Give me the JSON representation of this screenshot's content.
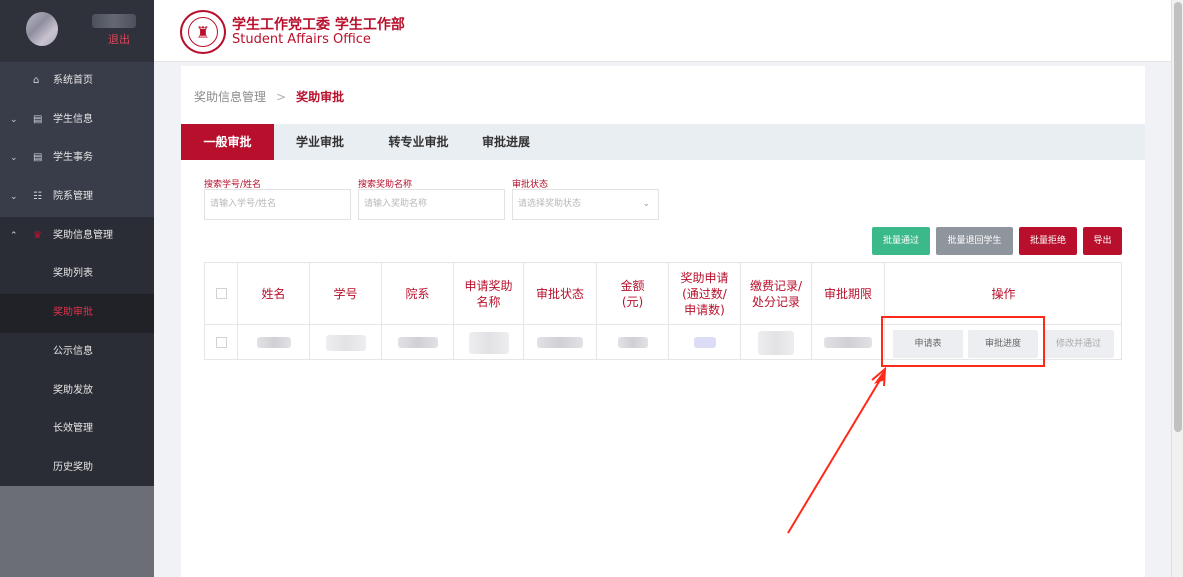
{
  "sidebar": {
    "logout": "退出",
    "items": [
      {
        "label": "系统首页",
        "icon": "home-icon"
      },
      {
        "label": "学生信息",
        "icon": "id-card-icon"
      },
      {
        "label": "学生事务",
        "icon": "id-card-icon"
      },
      {
        "label": "院系管理",
        "icon": "group-icon"
      },
      {
        "label": "奖助信息管理",
        "icon": "award-icon"
      }
    ],
    "submenu": [
      "奖助列表",
      "奖助审批",
      "公示信息",
      "奖助发放",
      "长效管理",
      "历史奖助"
    ]
  },
  "header": {
    "title": "学生工作党工委 学生工作部",
    "subtitle": "Student Affairs Office"
  },
  "breadcrumb": {
    "parent": "奖助信息管理",
    "separator": ">",
    "current": "奖助审批"
  },
  "tabs": [
    "一般审批",
    "学业审批",
    "转专业审批",
    "审批进展"
  ],
  "filters": [
    {
      "label": "搜索学号/姓名",
      "placeholder": "请输入学号/姓名"
    },
    {
      "label": "搜索奖助名称",
      "placeholder": "请输入奖助名称"
    },
    {
      "label": "审批状态",
      "placeholder": "请选择奖助状态"
    }
  ],
  "actions": {
    "batch_pass": "批量通过",
    "batch_return": "批量退回学生",
    "batch_reject": "批量拒绝",
    "export": "导出"
  },
  "table": {
    "headers": [
      "姓名",
      "学号",
      "院系",
      "申请奖助名称",
      "审批状态",
      "金额(元)",
      "奖助申请(通过数/申请数)",
      "缴费记录/处分记录",
      "审批期限",
      "操作"
    ],
    "row_ops": [
      "申请表",
      "审批进度",
      "修改并通过"
    ]
  },
  "colors": {
    "brand": "#b8102c",
    "pass": "#3cb98a",
    "return": "#8f959c",
    "annotation": "#ff2a1a"
  }
}
